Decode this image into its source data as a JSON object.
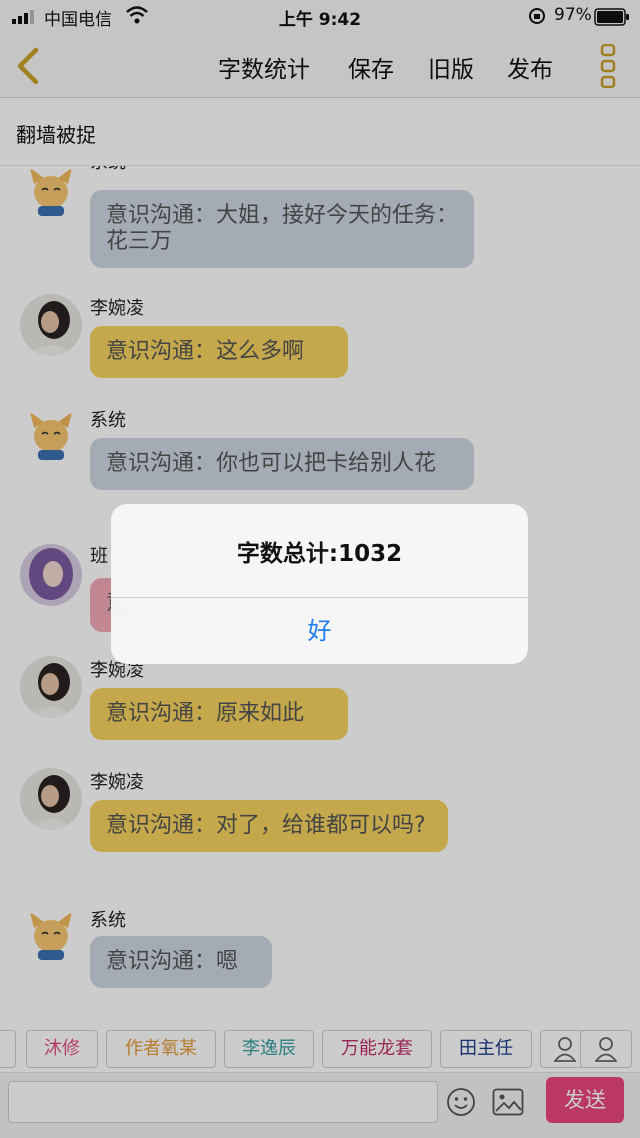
{
  "status_bar": {
    "carrier": "中国电信",
    "time": "上午 9:42",
    "battery": "97%"
  },
  "nav": {
    "word_count": "字数统计",
    "save": "保存",
    "old_version": "旧版",
    "publish": "发布"
  },
  "subheader": {
    "title": "翻墙被捉"
  },
  "chat": {
    "messages": [
      {
        "sender": "系统",
        "text": "意识沟通：大姐，接好今天的任务：花三万",
        "avatar": "fox-avatar",
        "style": "sys"
      },
      {
        "sender": "李婉凌",
        "text": "意识沟通：这么多啊",
        "avatar": "girl-avatar",
        "style": "gold"
      },
      {
        "sender": "系统",
        "text": "意识沟通：你也可以把卡给别人花",
        "avatar": "fox-avatar",
        "style": "sys"
      },
      {
        "sender": "班",
        "text": "意",
        "avatar": "purple-hair-avatar",
        "style": "pink"
      },
      {
        "sender": "李婉凌",
        "text": "意识沟通：原来如此",
        "avatar": "girl-avatar",
        "style": "gold"
      },
      {
        "sender": "李婉凌",
        "text": "意识沟通：对了，给谁都可以吗?",
        "avatar": "girl-avatar",
        "style": "gold"
      },
      {
        "sender": "系统",
        "text": "意识沟通：嗯",
        "avatar": "fox-avatar",
        "style": "sys"
      }
    ]
  },
  "chips": [
    {
      "label": "沐修",
      "color": "#e0507a"
    },
    {
      "label": "作者氧某",
      "color": "#e59a3a"
    },
    {
      "label": "李逸辰",
      "color": "#3aa0a0"
    },
    {
      "label": "万能龙套",
      "color": "#c0306a"
    },
    {
      "label": "田主任",
      "color": "#1f3c8a"
    }
  ],
  "input": {
    "placeholder": "",
    "send_label": "发送"
  },
  "dialog": {
    "title": "字数总计:1032",
    "ok_label": "好"
  }
}
